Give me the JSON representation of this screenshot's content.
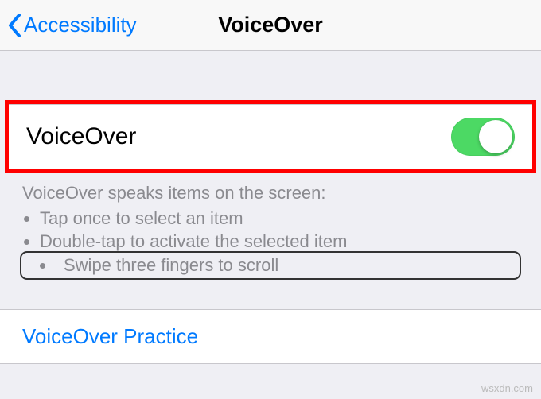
{
  "nav": {
    "back_label": "Accessibility",
    "title": "VoiceOver"
  },
  "toggle": {
    "label": "VoiceOver",
    "on": true
  },
  "description": {
    "intro": "VoiceOver speaks items on the screen:",
    "bullets": [
      "Tap once to select an item",
      "Double-tap to activate the selected item",
      "Swipe three fingers to scroll"
    ]
  },
  "practice": {
    "label": "VoiceOver Practice"
  },
  "watermark": "wsxdn.com"
}
